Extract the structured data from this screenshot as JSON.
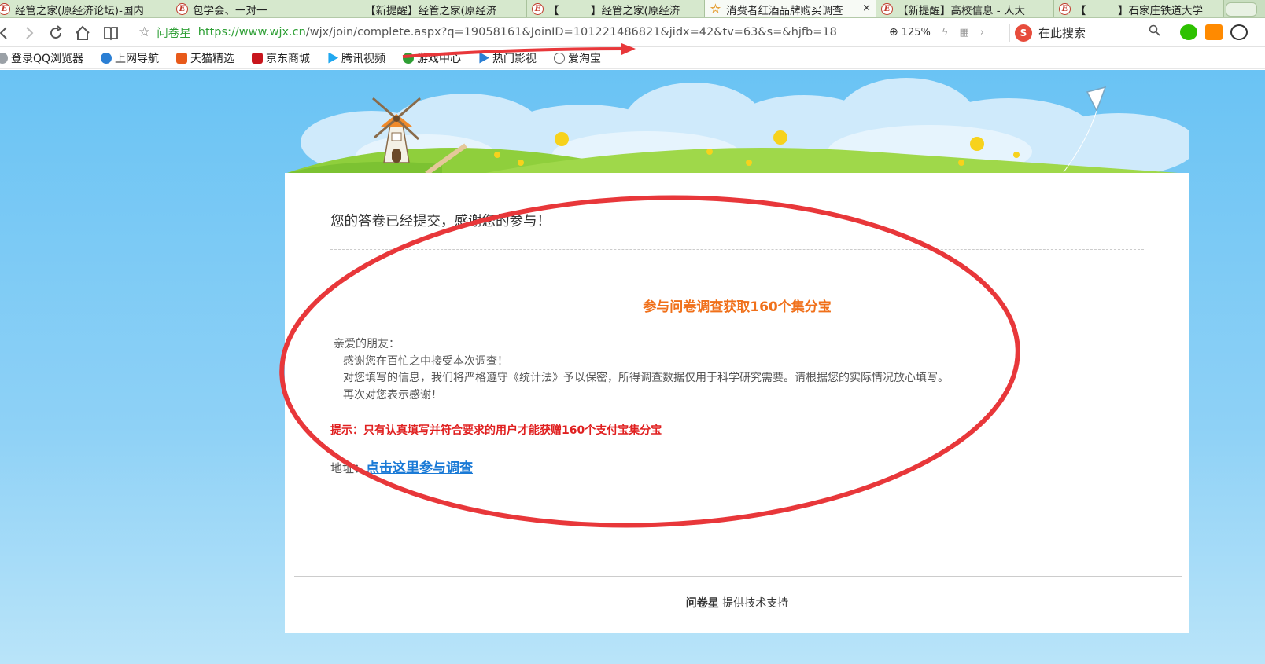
{
  "tabs": [
    {
      "title": "经管之家(原经济论坛)-国内",
      "icon": "jgzj-logo-icon",
      "active": false
    },
    {
      "title": "包学会、一对一",
      "icon": "jgzj-logo-icon",
      "active": false
    },
    {
      "title": "【新提醒】经管之家(原经济",
      "icon": "jgzj-logo-icon",
      "active": false
    },
    {
      "title": "【　　　】经管之家(原经济",
      "icon": "jgzj-logo-icon",
      "active": false
    },
    {
      "title": "消费者红酒品牌购买调查",
      "icon": "star-icon",
      "active": true,
      "close": "×"
    },
    {
      "title": "【新提醒】高校信息 - 人大",
      "icon": "jgzj-logo-icon",
      "active": false
    },
    {
      "title": "【　　　】石家庄铁道大学",
      "icon": "jgzj-logo-icon",
      "active": false
    }
  ],
  "address_bar": {
    "site_name": "问卷星",
    "url_scheme_host": "https://www.wjx.cn",
    "url_rest": "/wjx/join/complete.aspx?q=19058161&JoinID=101221486821&jidx=42&tv=63&s=&hjfb=18",
    "zoom": "125%",
    "search_engine": "S",
    "search_placeholder": "在此搜索"
  },
  "bookmarks": [
    {
      "label": "登录QQ浏览器",
      "icon": "qq-browser-icon",
      "color": "#9aa0a6"
    },
    {
      "label": "上网导航",
      "icon": "ie-icon",
      "color": "#2b7fd4"
    },
    {
      "label": "天猫精选",
      "icon": "tmall-icon",
      "color": "#e85a1a"
    },
    {
      "label": "京东商城",
      "icon": "jd-icon",
      "color": "#c8161d"
    },
    {
      "label": "腾讯视频",
      "icon": "tencent-video-icon",
      "color": "#20a8f0"
    },
    {
      "label": "游戏中心",
      "icon": "game-icon",
      "color": "#2e9f35"
    },
    {
      "label": "热门影视",
      "icon": "film-icon",
      "color": "#2b7fd4"
    },
    {
      "label": "爱淘宝",
      "icon": "globe-icon",
      "color": "#666666"
    }
  ],
  "page": {
    "thanks_message": "您的答卷已经提交，感谢您的参与！",
    "promo_title": "参与问卷调查获取160个集分宝",
    "greeting": "亲爱的朋友：",
    "line1": "感谢您在百忙之中接受本次调查！",
    "line2": "对您填写的信息，我们将严格遵守《统计法》予以保密，所得调查数据仅用于科学研究需要。请根据您的实际情况放心填写。",
    "line3": "再次对您表示感谢！",
    "tip": "提示：只有认真填写并符合要求的用户才能获赠160个支付宝集分宝",
    "address_label": "地址：",
    "address_link": "点击这里参与调查",
    "footer_brand": "问卷星",
    "footer_text": " 提供技术支持"
  },
  "colors": {
    "promo": "#f0701a",
    "tip": "#e02020",
    "link": "#1a7ad6",
    "annotation": "#e8373a",
    "sky": "#6ac3f4"
  }
}
